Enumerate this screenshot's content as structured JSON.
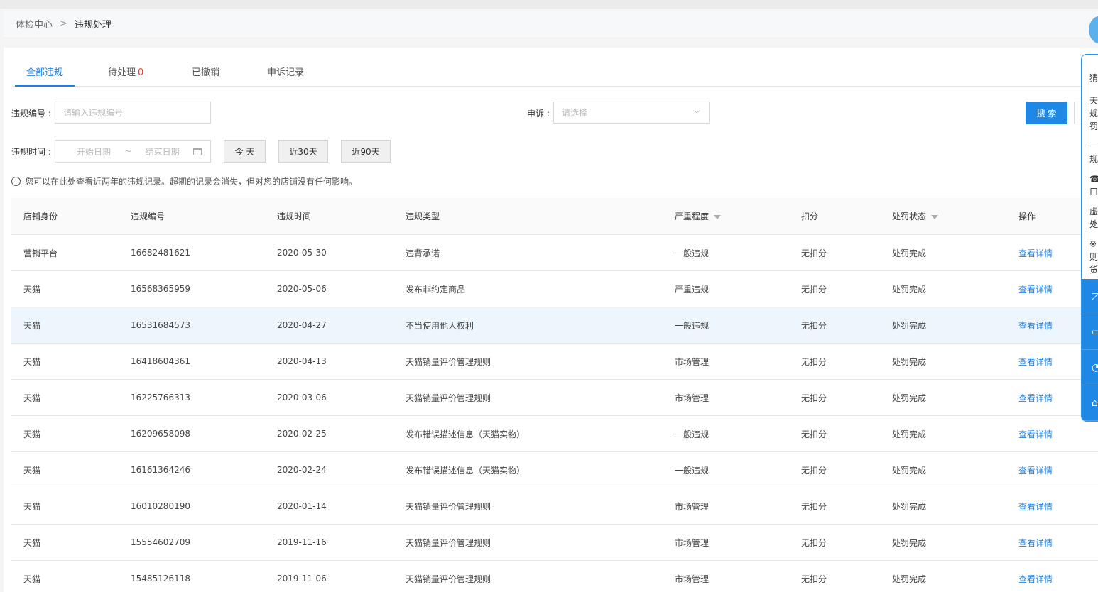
{
  "breadcrumb": {
    "home": "体检中心",
    "separator": ">",
    "current": "违规处理"
  },
  "tabs": [
    {
      "label": "全部违规",
      "count": ""
    },
    {
      "label": "待处理",
      "count": "0"
    },
    {
      "label": "已撤销",
      "count": ""
    },
    {
      "label": "申诉记录",
      "count": ""
    }
  ],
  "filters": {
    "violation_no_label": "违规编号 :",
    "violation_no_placeholder": "请输入违规编号",
    "appeal_label": "申诉 :",
    "appeal_placeholder": "请选择",
    "date_label": "违规时间 :",
    "start_placeholder": "开始日期",
    "range_sep": "~",
    "end_placeholder": "结束日期",
    "today": "今 天",
    "last30": "近30天",
    "last90": "近90天",
    "search": "搜 索"
  },
  "notice": "您可以在此处查看近两年的违规记录。超期的记录会消失，但对您的店铺没有任何影响。",
  "table": {
    "headers": [
      "店铺身份",
      "违规编号",
      "违规时间",
      "违规类型",
      "严重程度",
      "扣分",
      "处罚状态",
      "操作"
    ],
    "rows": [
      [
        "营销平台",
        "16682481621",
        "2020-05-30",
        "违背承诺",
        "一般违规",
        "无扣分",
        "处罚完成",
        "查看详情"
      ],
      [
        "天猫",
        "16568365959",
        "2020-05-06",
        "发布非约定商品",
        "严重违规",
        "无扣分",
        "处罚完成",
        "查看详情"
      ],
      [
        "天猫",
        "16531684573",
        "2020-04-27",
        "不当使用他人权利",
        "一般违规",
        "无扣分",
        "处罚完成",
        "查看详情"
      ],
      [
        "天猫",
        "16418604361",
        "2020-04-13",
        "天猫销量评价管理规则",
        "市场管理",
        "无扣分",
        "处罚完成",
        "查看详情"
      ],
      [
        "天猫",
        "16225766313",
        "2020-03-06",
        "天猫销量评价管理规则",
        "市场管理",
        "无扣分",
        "处罚完成",
        "查看详情"
      ],
      [
        "天猫",
        "16209658098",
        "2020-02-25",
        "发布错误描述信息（天猫实物）",
        "一般违规",
        "无扣分",
        "处罚完成",
        "查看详情"
      ],
      [
        "天猫",
        "16161364246",
        "2020-02-24",
        "发布错误描述信息（天猫实物）",
        "一般违规",
        "无扣分",
        "处罚完成",
        "查看详情"
      ],
      [
        "天猫",
        "16010280190",
        "2020-01-14",
        "天猫销量评价管理规则",
        "市场管理",
        "无扣分",
        "处罚完成",
        "查看详情"
      ],
      [
        "天猫",
        "15554602709",
        "2019-11-16",
        "天猫销量评价管理规则",
        "市场管理",
        "无扣分",
        "处罚完成",
        "查看详情"
      ],
      [
        "天猫",
        "15485126118",
        "2019-11-06",
        "天猫销量评价管理规则",
        "市场管理",
        "无扣分",
        "处罚完成",
        "查看详情"
      ]
    ]
  },
  "side_panel": {
    "lines": [
      "猜",
      "天",
      "规",
      "罚",
      "一",
      "规",
      "☎",
      "口",
      "虚",
      "处",
      "※",
      "则",
      "货"
    ]
  }
}
